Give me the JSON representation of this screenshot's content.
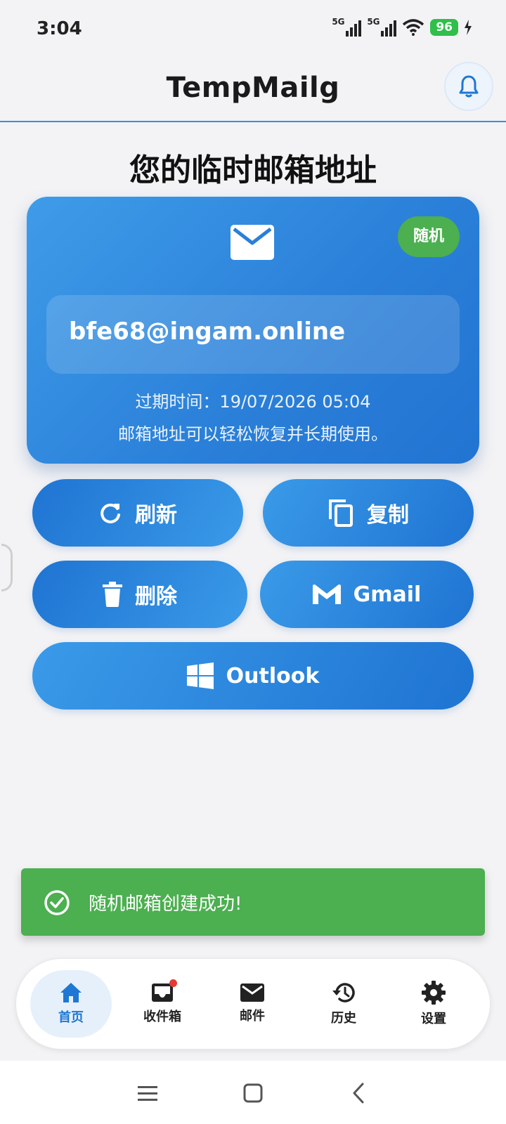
{
  "status_bar": {
    "time": "3:04",
    "network_1": "5G",
    "network_2": "5G",
    "battery": "96"
  },
  "header": {
    "title": "TempMailg",
    "bell_icon": "bell-icon"
  },
  "page": {
    "section_title": "您的临时邮箱地址"
  },
  "email_card": {
    "icon": "envelope-icon",
    "badge": "随机",
    "address": "bfe68@ingam.online",
    "expiry": "过期时间：19/07/2026 05:04",
    "note": "邮箱地址可以轻松恢复并长期使用。"
  },
  "actions": {
    "refresh": {
      "label": "刷新",
      "icon": "refresh-icon"
    },
    "copy": {
      "label": "复制",
      "icon": "copy-icon"
    },
    "delete": {
      "label": "删除",
      "icon": "trash-icon"
    },
    "gmail": {
      "label": "Gmail",
      "icon": "gmail-icon"
    },
    "outlook": {
      "label": "Outlook",
      "icon": "windows-icon"
    }
  },
  "toast": {
    "icon": "check-circle-icon",
    "message": "随机邮箱创建成功!"
  },
  "bottom_nav": {
    "items": [
      {
        "label": "首页",
        "icon": "home-icon",
        "active": true
      },
      {
        "label": "收件箱",
        "icon": "inbox-icon",
        "active": false
      },
      {
        "label": "邮件",
        "icon": "mail-icon",
        "active": false
      },
      {
        "label": "历史",
        "icon": "history-icon",
        "active": false
      },
      {
        "label": "设置",
        "icon": "gear-icon",
        "active": false
      }
    ]
  },
  "colors": {
    "accent": "#2a7fd8",
    "success": "#4caf50",
    "background": "#f3f3f5"
  }
}
